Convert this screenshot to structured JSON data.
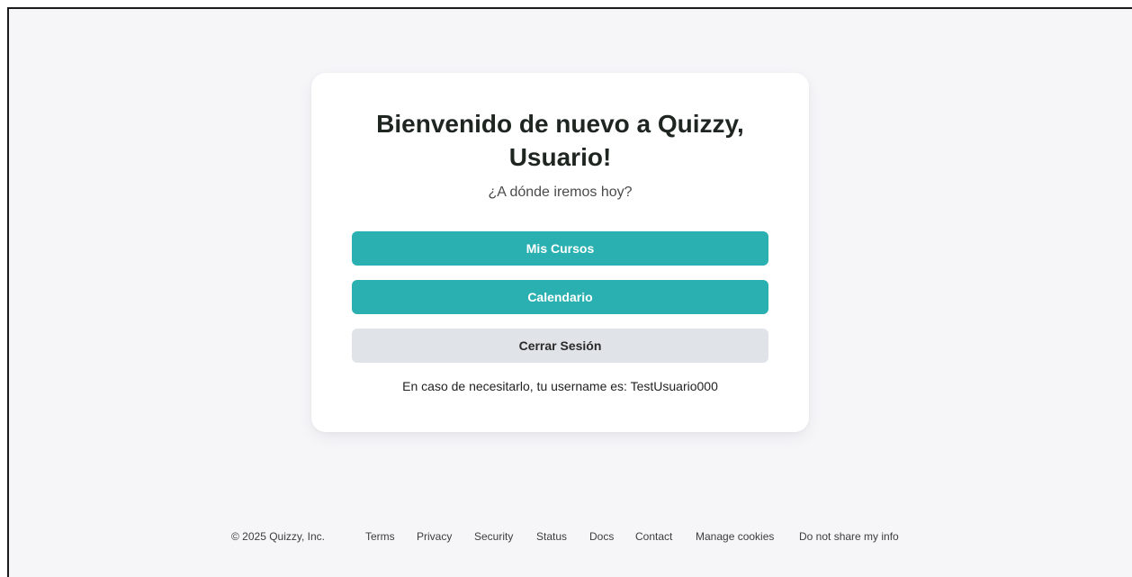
{
  "card": {
    "title": "Bienvenido de nuevo a Quizzy, Usuario!",
    "subtitle": "¿A dónde iremos hoy?",
    "buttons": {
      "courses": "Mis Cursos",
      "calendar": "Calendario",
      "logout": "Cerrar Sesión"
    },
    "username_note": "En caso de necesitarlo, tu username es: TestUsuario000"
  },
  "footer": {
    "copyright": "© 2025 Quizzy, Inc.",
    "links": [
      "Terms",
      "Privacy",
      "Security",
      "Status",
      "Docs",
      "Contact",
      "Manage cookies",
      "Do not share my info"
    ]
  },
  "colors": {
    "primary_button": "#2ab0b1",
    "secondary_button": "#e0e4e8",
    "page_background": "#f6f6f9",
    "card_background": "#ffffff"
  }
}
